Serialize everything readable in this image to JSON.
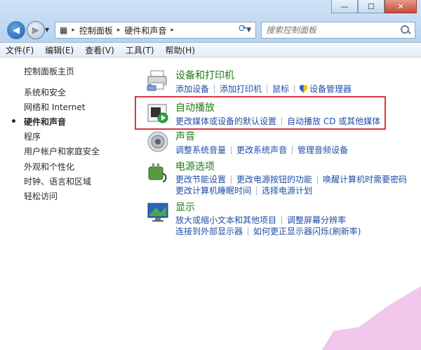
{
  "window": {
    "controls": {
      "minimize": "—",
      "maximize": "☐",
      "close": "✕"
    }
  },
  "address": {
    "segments": [
      "控制面板",
      "硬件和声音"
    ],
    "search_placeholder": "搜索控制面板"
  },
  "menubar": [
    "文件(F)",
    "编辑(E)",
    "查看(V)",
    "工具(T)",
    "帮助(H)"
  ],
  "leftnav": {
    "home": "控制面板主页",
    "items": [
      "系统和安全",
      "网络和 Internet",
      "硬件和声音",
      "程序",
      "用户帐户和家庭安全",
      "外观和个性化",
      "时钟、语言和区域",
      "轻松访问"
    ],
    "active_index": 2
  },
  "categories": [
    {
      "title": "设备和打印机",
      "icon": "printer-icon",
      "rows": [
        [
          "添加设备",
          "添加打印机",
          "鼠标",
          "设备管理器"
        ]
      ]
    },
    {
      "title": "自动播放",
      "icon": "autoplay-icon",
      "rows": [
        [
          "更改媒体或设备的默认设置",
          "自动播放 CD 或其他媒体"
        ]
      ]
    },
    {
      "title": "声音",
      "icon": "speaker-icon",
      "rows": [
        [
          "调整系统音量",
          "更改系统声音",
          "管理音频设备"
        ]
      ]
    },
    {
      "title": "电源选项",
      "icon": "power-icon",
      "rows": [
        [
          "更改节能设置",
          "更改电源按钮的功能",
          "唤醒计算机时需要密码"
        ],
        [
          "更改计算机睡眠时间",
          "选择电源计划"
        ]
      ]
    },
    {
      "title": "显示",
      "icon": "display-icon",
      "rows": [
        [
          "放大或缩小文本和其他项目",
          "调整屏幕分辨率"
        ],
        [
          "连接到外部显示器",
          "如何更正显示器闪烁(刷新率)"
        ]
      ]
    }
  ],
  "colors": {
    "category_title": "#1e7b15",
    "link": "#1f4ea6",
    "highlight_border": "#d9363e"
  }
}
